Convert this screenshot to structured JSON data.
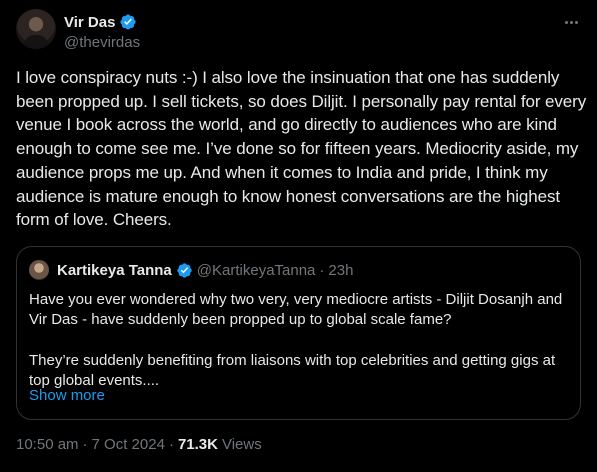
{
  "author": {
    "display_name": "Vir Das",
    "handle": "@thevirdas",
    "verified": true
  },
  "tweet_text": "I love conspiracy nuts :-) I also love the insinuation that one has suddenly been propped up. I sell tickets, so does Diljit. I personally pay rental for every venue I book across the world, and go directly to audiences who are kind enough to come see me. I’ve done so for fifteen years. Mediocrity aside, my audience props me up. And when it comes to India and pride, I think my audience is mature enough to know honest conversations are the highest form of love. Cheers.",
  "quoted_tweet": {
    "display_name": "Kartikeya Tanna",
    "handle": "@KartikeyaTanna",
    "separator": "·",
    "time_ago": "23h",
    "text": "Have you ever wondered why two very, very mediocre artists - Diljit Dosanjh and Vir Das - have suddenly been propped up to global scale fame?\n\nThey’re suddenly benefiting from liaisons with top celebrities and getting gigs at top global events....",
    "show_more": "Show more"
  },
  "meta": {
    "time": "10:50 am",
    "separator": "·",
    "date": "7 Oct 2024",
    "views_count": "71.3K",
    "views_label": "Views"
  },
  "colors": {
    "background": "#000000",
    "text": "#e7e9ea",
    "muted": "#71767b",
    "accent": "#1d9bf0",
    "border": "#2f3336"
  },
  "icons": {
    "verified": "verified-badge-icon",
    "more": "more-options-icon"
  }
}
